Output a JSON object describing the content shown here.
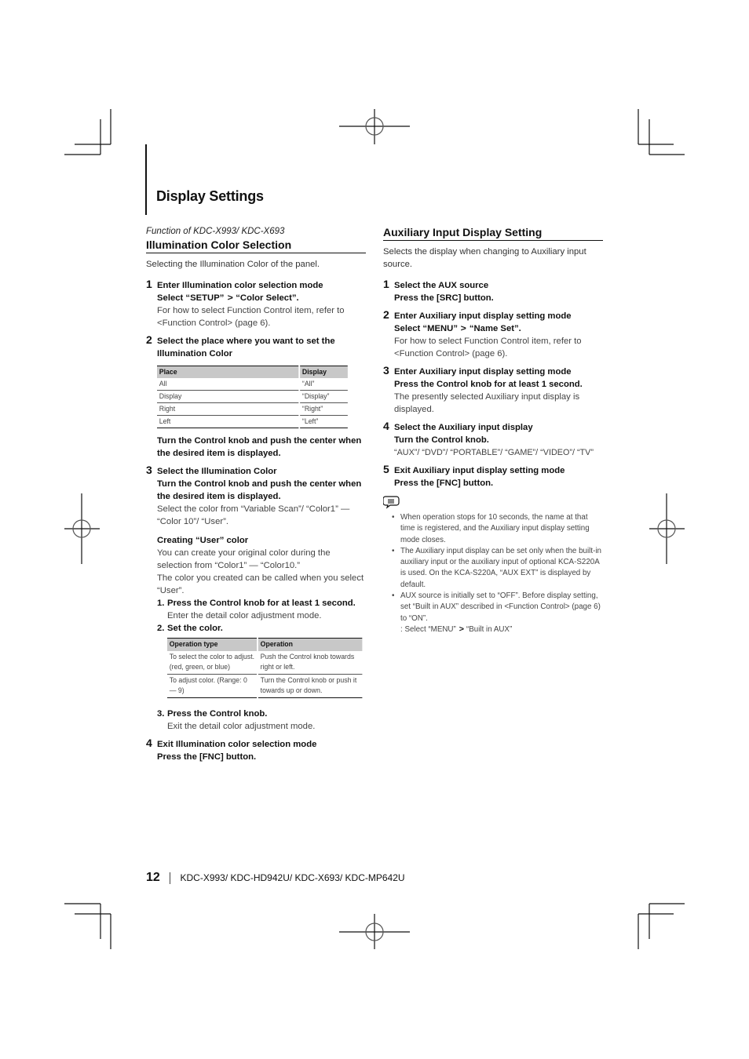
{
  "page": {
    "title": "Display Settings",
    "page_number": "12",
    "footer_models": "KDC-X993/ KDC-HD942U/ KDC-X693/ KDC-MP642U"
  },
  "left": {
    "function_of": "Function of KDC-X993/ KDC-X693",
    "heading": "Illumination Color Selection",
    "intro": "Selecting the Illumination Color of the panel.",
    "steps": [
      {
        "num": "1",
        "title": "Enter Illumination color selection mode",
        "select_pre": "Select “SETUP”",
        "select_post": "“Color Select”.",
        "note": "For how to select Function Control item, refer to <Function Control> (page 6)."
      },
      {
        "num": "2",
        "title": "Select the place where you want to set the Illumination Color",
        "after_table": "Turn the Control knob and push the center when the desired item is displayed."
      },
      {
        "num": "3",
        "title": "Select the Illumination Color",
        "action": "Turn the Control knob and push the center when the desired item is displayed.",
        "note": "Select the color from “Variable Scan”/ “Color1” — “Color 10”/ “User”."
      },
      {
        "num": "4",
        "title": "Exit Illumination color selection mode",
        "action": "Press the [FNC] button."
      }
    ],
    "place_table": {
      "headers": [
        "Place",
        "Display"
      ],
      "rows": [
        [
          "All",
          "“All”"
        ],
        [
          "Display",
          "“Display”"
        ],
        [
          "Right",
          "“Right”"
        ],
        [
          "Left",
          "“Left”"
        ]
      ]
    },
    "user_color": {
      "heading": "Creating “User” color",
      "desc1": "You can create your original color during the selection from “Color1” — “Color10.”",
      "desc2": "The color you created can be called when you select “User”.",
      "sub_steps": [
        {
          "num": "1.",
          "title": "Press the Control knob for at least 1 second.",
          "note": "Enter the detail color adjustment mode."
        },
        {
          "num": "2.",
          "title": "Set the color.",
          "note": ""
        },
        {
          "num": "3.",
          "title": "Press the Control knob.",
          "note": "Exit the detail color adjustment mode."
        }
      ],
      "op_table": {
        "headers": [
          "Operation type",
          "Operation"
        ],
        "rows": [
          [
            "To select the color to adjust. (red, green, or blue)",
            "Push the Control knob towards right or left."
          ],
          [
            "To adjust color. (Range: 0 — 9)",
            "Turn the Control knob or push it towards up or down."
          ]
        ]
      }
    }
  },
  "right": {
    "heading": "Auxiliary Input Display Setting",
    "intro": "Selects the display when changing to Auxiliary input source.",
    "steps": [
      {
        "num": "1",
        "title": "Select the AUX source",
        "action": "Press the [SRC] button.",
        "note": ""
      },
      {
        "num": "2",
        "title": "Enter Auxiliary input display setting mode",
        "select_pre": "Select “MENU”",
        "select_post": "“Name Set”.",
        "note": "For how to select Function Control item, refer to <Function Control> (page 6)."
      },
      {
        "num": "3",
        "title": "Enter Auxiliary input display setting mode",
        "action": "Press the Control knob for at least 1 second.",
        "note": "The presently selected Auxiliary input display is displayed."
      },
      {
        "num": "4",
        "title": "Select the Auxiliary input display",
        "action": "Turn the Control knob.",
        "note": "“AUX”/ “DVD”/ “PORTABLE”/ “GAME”/ “VIDEO”/ “TV”"
      },
      {
        "num": "5",
        "title": "Exit Auxiliary input display setting mode",
        "action": "Press the [FNC] button.",
        "note": ""
      }
    ],
    "notes_icon": "memo-speech-bubble-icon",
    "notes": [
      "When operation stops for 10 seconds, the name at that time is registered, and the Auxiliary input display setting mode closes.",
      "The Auxiliary input display can be set only when the built-in auxiliary input or the auxiliary input of optional KCA-S220A is used. On the KCA-S220A, “AUX EXT” is displayed by default.",
      "AUX source is initially set to “OFF”. Before display setting, set “Built in AUX” described in <Function Control> (page 6) to “ON”."
    ],
    "note3_extra_pre": ": Select “MENU”",
    "note3_extra_post": "“Built in AUX”",
    "bullet": "•",
    "arrow": ">"
  }
}
